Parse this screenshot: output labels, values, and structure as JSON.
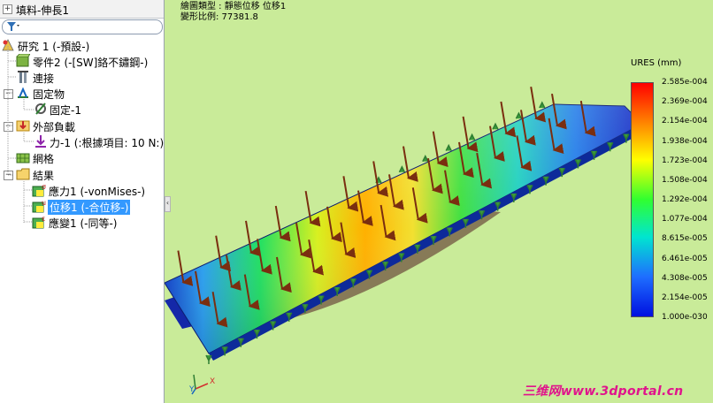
{
  "topbar": {
    "label": "填料-伸長1"
  },
  "filter": {
    "icon": "filter-icon"
  },
  "tree": {
    "items": [
      {
        "label": "研究 1 (-預設-)",
        "icon": "study-icon"
      },
      {
        "label": "零件2 (-[SW]鉻不鏽鋼-)",
        "icon": "part-icon"
      },
      {
        "label": "連接",
        "icon": "connections-icon"
      },
      {
        "label": "固定物",
        "icon": "fixtures-icon"
      },
      {
        "label": "固定-1",
        "icon": "fixed-icon"
      },
      {
        "label": "外部負載",
        "icon": "external-loads-icon"
      },
      {
        "label": "力-1 (:根據項目: 10 N:)",
        "icon": "force-icon"
      },
      {
        "label": "網格",
        "icon": "mesh-icon"
      },
      {
        "label": "結果",
        "icon": "results-icon"
      },
      {
        "label": "應力1 (-vonMises-)",
        "icon": "stress-plot-icon"
      },
      {
        "label": "位移1 (-合位移-)",
        "icon": "displacement-plot-icon"
      },
      {
        "label": "應變1 (-同等-)",
        "icon": "strain-plot-icon"
      }
    ]
  },
  "viewport": {
    "plot_type_label": "繪圖類型 : 靜態位移 位移1",
    "scale_label": "變形比例: 77381.8",
    "legend_title": "URES (mm)",
    "legend_ticks": [
      "2.585e-004",
      "2.369e-004",
      "2.154e-004",
      "1.938e-004",
      "1.723e-004",
      "1.508e-004",
      "1.292e-004",
      "1.077e-004",
      "8.615e-005",
      "6.461e-005",
      "4.308e-005",
      "2.154e-005",
      "1.000e-030"
    ],
    "triad": {
      "x": "X",
      "y": "Y"
    },
    "watermark": "三维网www.3dportal.cn"
  },
  "colors": {
    "background": "#c9eb99",
    "selected": "#3399ff",
    "arrow": "#8b3a1a",
    "watermark": "#e0148c"
  }
}
